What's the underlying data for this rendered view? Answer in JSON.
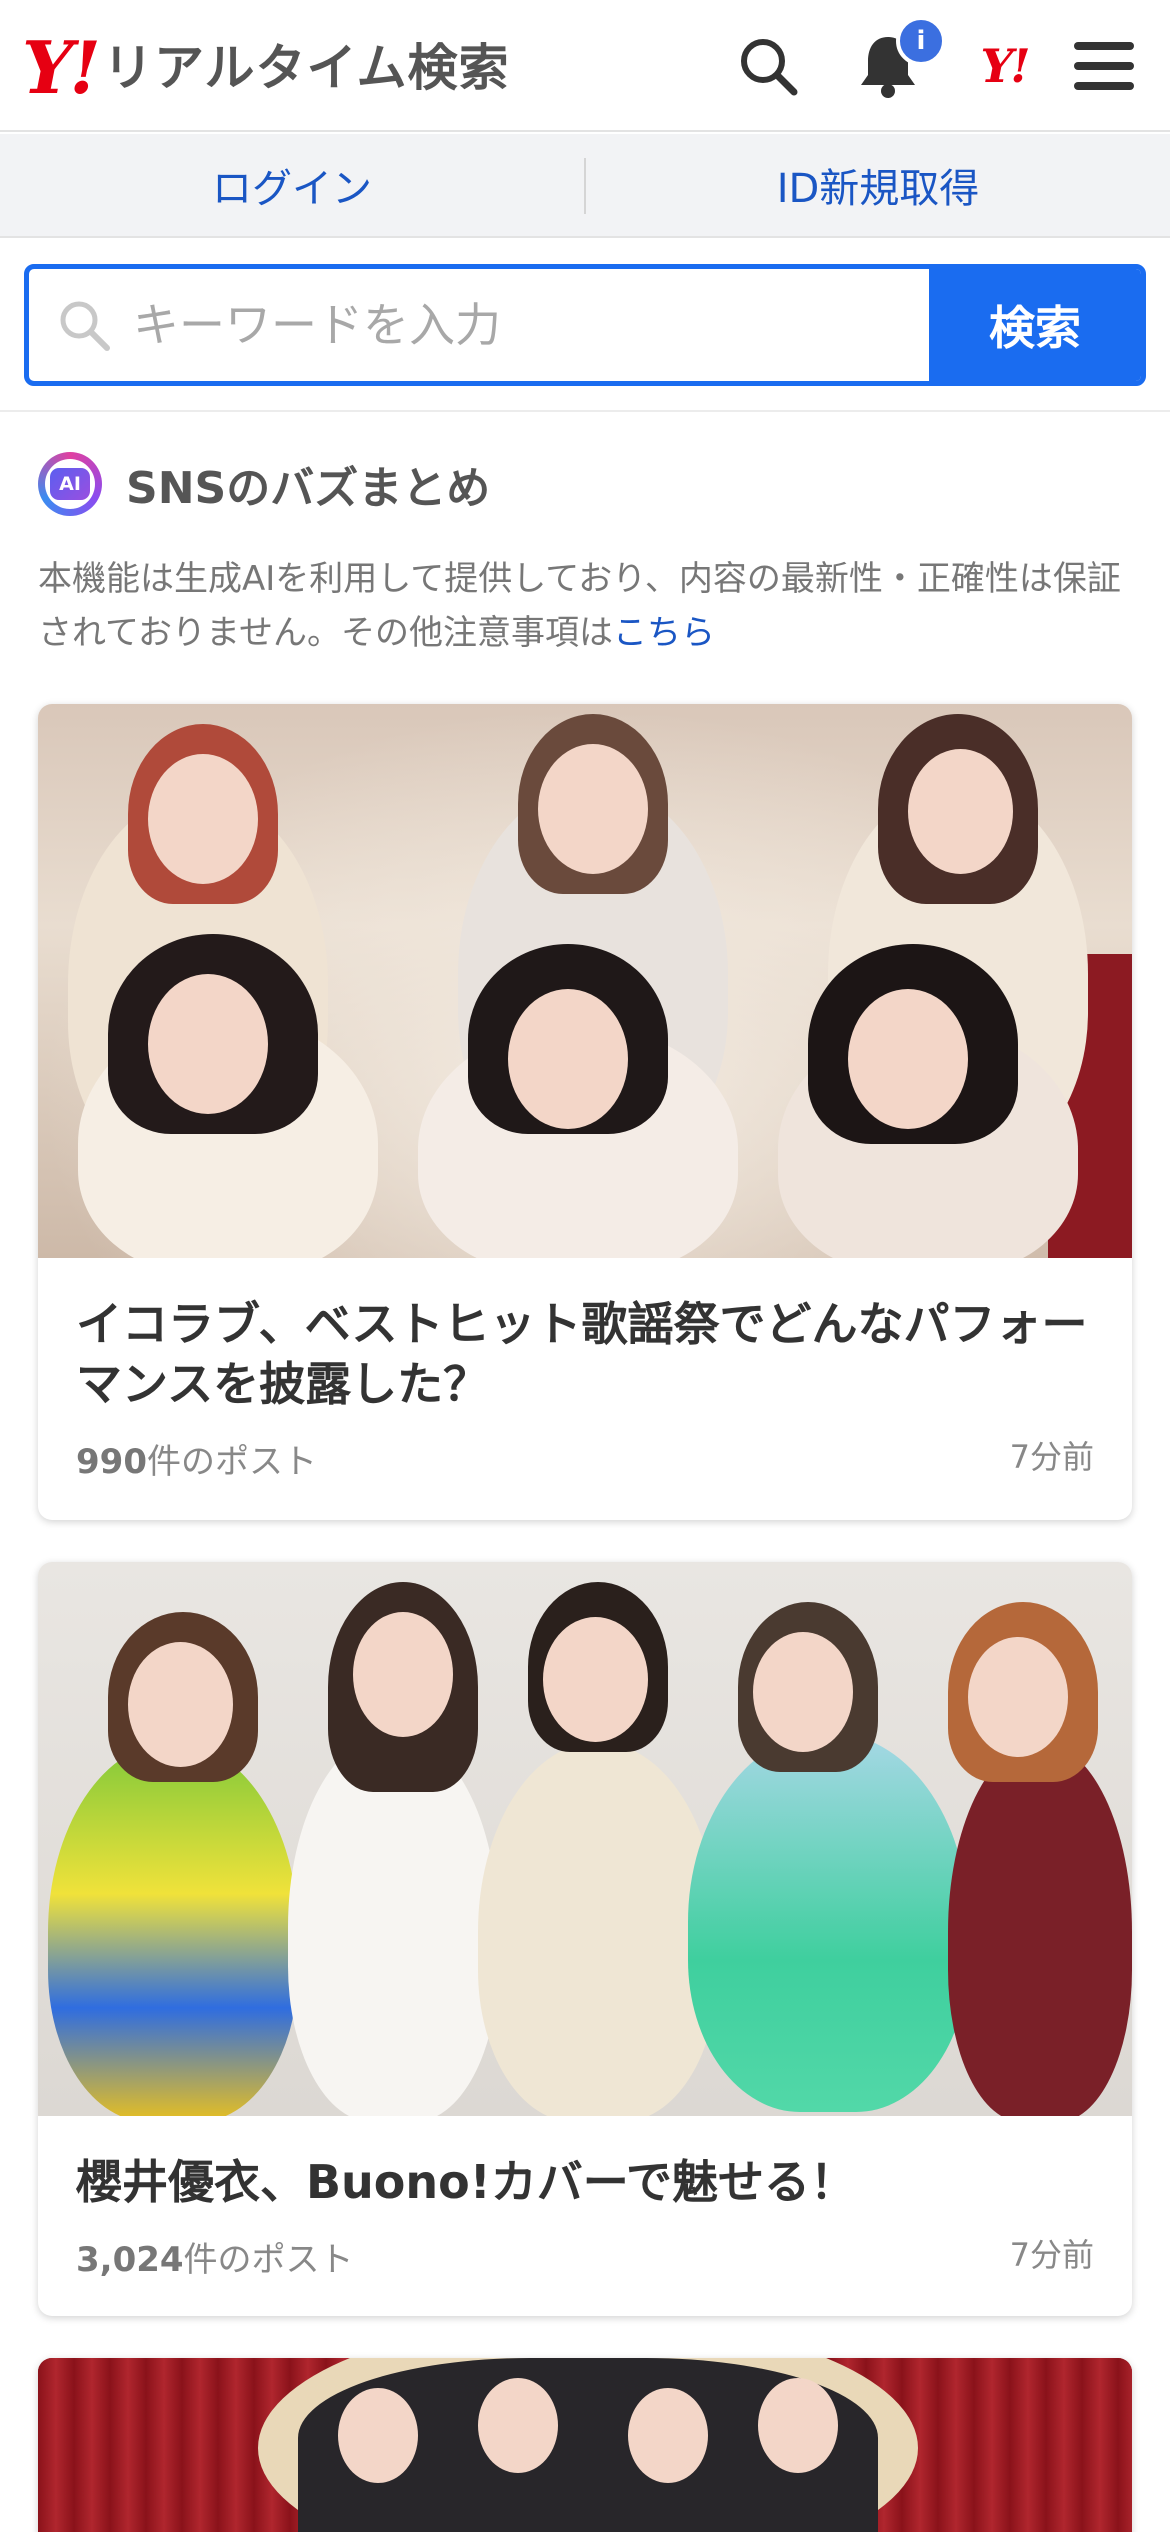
{
  "header": {
    "logo_mark": "Y!",
    "logo_text": "リアルタイム検索",
    "icons": [
      "search-icon",
      "bell-icon",
      "yahoo-logo-icon",
      "menu-icon"
    ],
    "notification_badge": "i",
    "yahoo_small": "Y!"
  },
  "auth": {
    "login": "ログイン",
    "signup": "ID新規取得"
  },
  "search": {
    "placeholder": "キーワードを入力",
    "button": "検索"
  },
  "sns": {
    "ai_badge": "AI",
    "title": "SNSのバズまとめ",
    "disclaimer_text": "本機能は生成AIを利用して提供しており、内容の最新性・正確性は保証されておりません。その他注意事項は",
    "disclaimer_link": "こちら"
  },
  "cards": [
    {
      "title": "イコラブ、ベストヒット歌謡祭でどんなパフォーマンスを披露した？",
      "count": "990",
      "count_suffix": "件のポスト",
      "time": "7分前"
    },
    {
      "title": "櫻井優衣、Buono!カバーで魅せる！",
      "count": "3,024",
      "count_suffix": "件のポスト",
      "time": "7分前"
    },
    {
      "title": "",
      "count": "",
      "count_suffix": "",
      "time": ""
    }
  ],
  "colors": {
    "brand_red": "#e60012",
    "accent_blue": "#1a6cf0",
    "link_blue": "#1a56c4"
  }
}
